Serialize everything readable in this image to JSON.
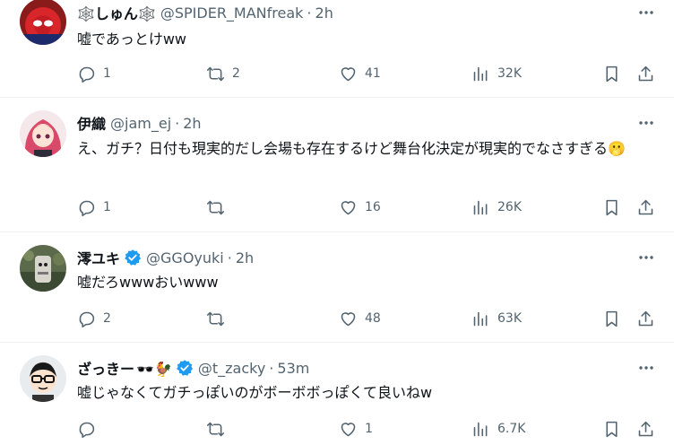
{
  "tweets": [
    {
      "name": "しゅん",
      "name_prefix_emoji": "🕸️",
      "name_suffix_emoji": "🕸️",
      "handle": "@SPIDER_MANfreak",
      "dot": "·",
      "time": "2h",
      "text": "嘘であっとけww",
      "verified": false,
      "replies": "1",
      "retweets": "2",
      "likes": "41",
      "views": "32K"
    },
    {
      "name": "伊織",
      "handle": "@jam_ej",
      "dot": "·",
      "time": "2h",
      "text": "え、ガチ？日付も現実的だし会場も存在するけど舞台化決定が現実的でなさすぎる🫢",
      "verified": false,
      "replies": "1",
      "retweets": "",
      "likes": "16",
      "views": "26K"
    },
    {
      "name": "澪ユキ",
      "handle": "@GGOyuki",
      "dot": "·",
      "time": "2h",
      "text": "嘘だろwwwおいwww",
      "verified": true,
      "replies": "2",
      "retweets": "",
      "likes": "48",
      "views": "63K"
    },
    {
      "name": "ざっきー",
      "name_suffix_emoji": "🕶️🐓",
      "handle": "@t_zacky",
      "dot": "·",
      "time": "53m",
      "text": "嘘じゃなくてガチっぽいのがボーボボっぽくて良いねw",
      "verified": true,
      "replies": "",
      "retweets": "",
      "likes": "1",
      "views": "6.7K"
    }
  ],
  "icons": {
    "reply": "reply-icon",
    "retweet": "retweet-icon",
    "like": "heart-icon",
    "views": "views-icon",
    "bookmark": "bookmark-icon",
    "share": "share-icon",
    "more": "more-icon",
    "verified": "verified-badge-icon"
  },
  "colors": {
    "text": "#0f1419",
    "muted": "#536471",
    "verified": "#1d9bf0",
    "divider": "#eff3f4"
  }
}
